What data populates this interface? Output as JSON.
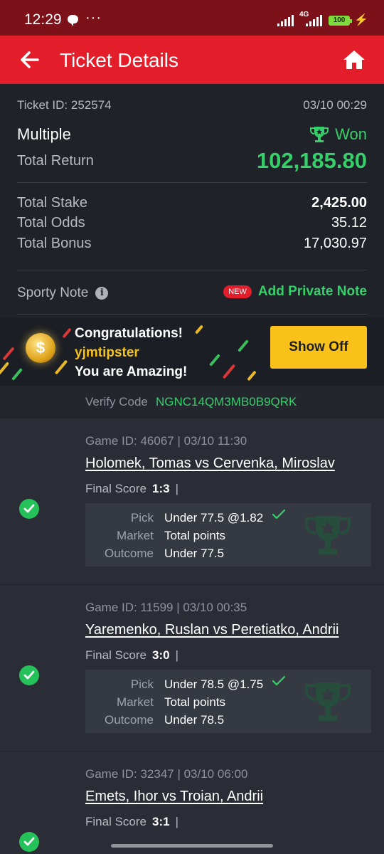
{
  "status_bar": {
    "time": "12:29",
    "dots": "···",
    "network": "4G",
    "battery": "100",
    "icons": [
      "chat-icon",
      "signal-icon",
      "battery-icon",
      "charging-icon"
    ]
  },
  "header": {
    "title": "Ticket Details",
    "back_icon": "arrow-left-icon",
    "home_icon": "home-icon"
  },
  "ticket": {
    "id_label": "Ticket ID: 252574",
    "datetime": "03/10 00:29",
    "type": "Multiple",
    "status": "Won",
    "total_return_label": "Total Return",
    "total_return": "102,185.80",
    "total_stake_label": "Total Stake",
    "total_stake": "2,425.00",
    "total_odds_label": "Total Odds",
    "total_odds": "35.12",
    "total_bonus_label": "Total Bonus",
    "total_bonus": "17,030.97"
  },
  "note": {
    "label": "Sporty Note",
    "badge": "NEW",
    "action": "Add Private Note"
  },
  "banner": {
    "line1": "Congratulations!",
    "line2": "yjmtipster",
    "line3": "You are Amazing!",
    "button": "Show Off",
    "coin_symbol": "$"
  },
  "verify": {
    "label": "Verify Code",
    "code": "NGNC14QM3MB0B9QRK"
  },
  "games": [
    {
      "header": "Game ID: 46067 | 03/10 11:30",
      "teams": "Holomek, Tomas vs Cervenka, Miroslav",
      "score_label": "Final Score",
      "score": "1:3",
      "sep": "|",
      "pick_label": "Pick",
      "pick": "Under 77.5 @1.82",
      "market_label": "Market",
      "market": "Total points",
      "outcome_label": "Outcome",
      "outcome": "Under 77.5"
    },
    {
      "header": "Game ID: 11599 | 03/10 00:35",
      "teams": "Yaremenko, Ruslan vs Peretiatko, Andrii",
      "score_label": "Final Score",
      "score": "3:0",
      "sep": "|",
      "pick_label": "Pick",
      "pick": "Under 78.5 @1.75",
      "market_label": "Market",
      "market": "Total points",
      "outcome_label": "Outcome",
      "outcome": "Under 78.5"
    },
    {
      "header": "Game ID: 32347 | 03/10 06:00",
      "teams": "Emets, Ihor vs Troian, Andrii",
      "score_label": "Final Score",
      "score": "3:1",
      "sep": "|"
    }
  ],
  "colors": {
    "brand_red": "#e41d2b",
    "win_green": "#36d06a",
    "button_yellow": "#f9c11a",
    "background": "#1f2229"
  }
}
